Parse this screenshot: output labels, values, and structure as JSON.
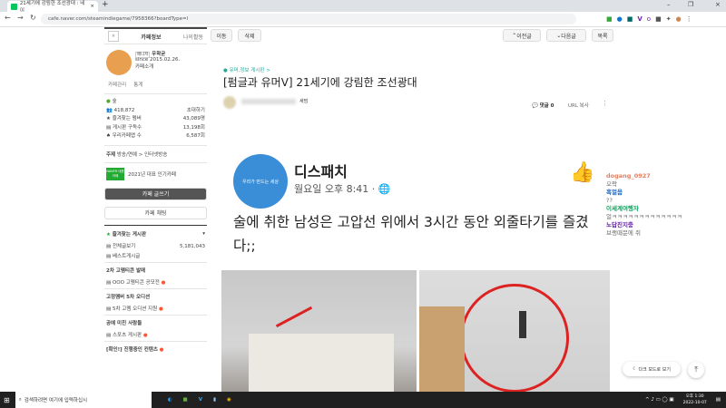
{
  "browser": {
    "tab_title": "21세기에 강림한 조선광대 : 네이",
    "url": "cafe.naver.com/steamindiegame/7958366?boardType=l"
  },
  "sidebar": {
    "tabs": [
      "카페정보",
      "나의활동"
    ],
    "manager_badge": "매니저",
    "manager_name": "우왁굳",
    "since": "since 2015.02.26.",
    "cafe_intro": "카페소개",
    "links": [
      "카페관리",
      "통계"
    ],
    "level": "숲",
    "members": "418,872",
    "invite": "초대하기",
    "stats": [
      {
        "label": "즐겨찾는 멤버",
        "value": "43,089명"
      },
      {
        "label": "게시판 구독수",
        "value": "13,198회"
      },
      {
        "label": "우리카페앱 수",
        "value": "6,587회"
      }
    ],
    "theme_label": "주제",
    "theme": "방송/연예 > 인터넷방송",
    "naver_badge": "NAVER 대표카페",
    "award": "2021년 대표 인기카페",
    "write_button": "카페 글쓰기",
    "chat_button": "카페 채팅",
    "fav_boards": "즐겨찾는 게시판",
    "boards": [
      {
        "type": "item",
        "label": "전체글보기",
        "count": "5,181,043"
      },
      {
        "type": "item",
        "label": "베스트게시글"
      },
      {
        "type": "head",
        "label": "2차 고멤티콘 발매"
      },
      {
        "type": "item",
        "label": "OOO 고멤티콘 공모전",
        "new": true
      },
      {
        "type": "head",
        "label": "고정멤버 5차 오디션"
      },
      {
        "type": "item",
        "label": "5차 고멤 오디션 지원",
        "new": true
      },
      {
        "type": "head",
        "label": "공예 미친 사람들"
      },
      {
        "type": "item",
        "label": "스포츠 게시판",
        "new": true
      },
      {
        "type": "head",
        "label": "[확인!] 진행중인 컨텐츠",
        "new": true
      }
    ]
  },
  "toolbar": {
    "move": "이동",
    "delete": "삭제",
    "prev": "이전글",
    "next": "다음글",
    "list": "목록"
  },
  "post": {
    "board": "유머,정보 게시판 >",
    "title": "[펌글과 유머ᐯ] 21세기에 강림한 조선광대",
    "author_suffix": "새덤",
    "comments": "댓글 0",
    "url_copy": "URL 복사"
  },
  "embed": {
    "source": "디스패치",
    "logo_text": "우리가 만드는 세상",
    "time": "월요일 오후 8:41 · ",
    "text": "술에 취한 남성은 고압선 위에서 3시간 동안 외줄타기를 즐겼다;;"
  },
  "chat": [
    {
      "user": "dogang_0927",
      "msg": "오락",
      "color": "#e08060"
    },
    {
      "user": "흑얼음",
      "msg": "??",
      "color": "#1060c0"
    },
    {
      "user": "이세계여행자",
      "msg": "얼ㅋㅋㅋㅋㅋㅋㅋㅋㅋㅋㅋㅋㅋ",
      "color": "#10a060"
    },
    {
      "user": "노답진지충",
      "msg": "브랭때문에 쥐",
      "color": "#6020a0"
    }
  ],
  "float": {
    "dark_mode": "다크 모드로 보기"
  },
  "taskbar": {
    "search": "검색하려면 여기에 입력하십시",
    "time": "오후 1:30",
    "date": "2022-10-07"
  }
}
